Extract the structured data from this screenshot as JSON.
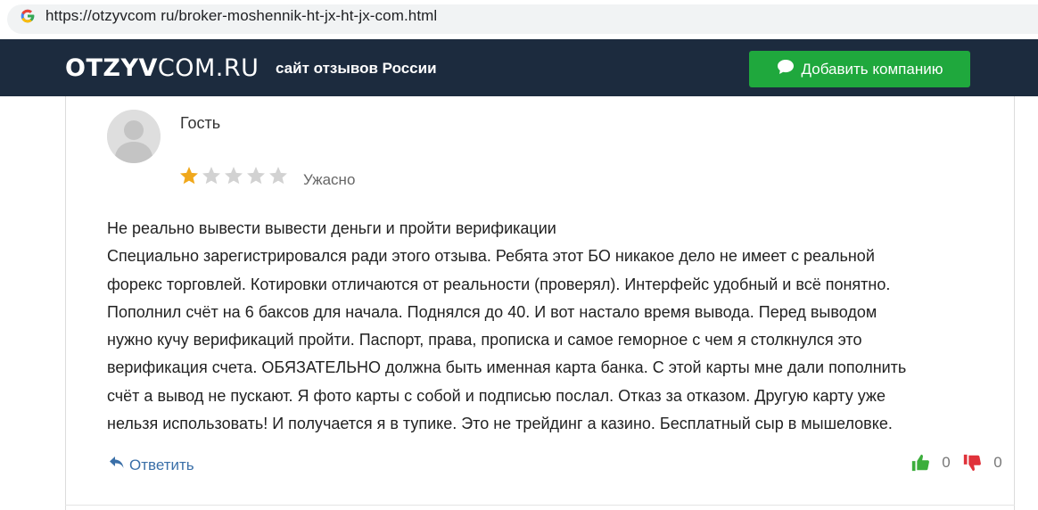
{
  "browser": {
    "url": "https://otzyvcom ru/broker-moshennik-ht-jx-ht-jx-com.html",
    "favicon_icon": "google-g-icon"
  },
  "header": {
    "logo_bold": "OTZYV",
    "logo_rest": "COM.RU",
    "tagline": "сайт отзывов России",
    "add_button_label": "Добавить компанию",
    "add_button_icon": "chat-bubble-icon",
    "accent_color": "#1fa83d",
    "bg_color": "#1c2b3e"
  },
  "review": {
    "author": "Гость",
    "avatar_icon": "user-avatar-icon",
    "rating": 1,
    "rating_max": 5,
    "rating_label": "Ужасно",
    "star_color": "#f0a81c",
    "title": "Не реально вывести вывести деньги и пройти верификации",
    "body_lines": [
      "Специально зарегистрировался ради этого отзыва. Ребята этот БО никакое дело не имеет с реальной",
      "форекс торговлей. Котировки отличаются от реальности (проверял). Интерфейс удобный и всё понятно.",
      "Пополнил счёт на 6 баксов для начала. Поднялся до 40. И вот настало время вывода. Перед выводом",
      "нужно кучу верификаций пройти. Паспорт, права, прописка и самое геморное с чем я столкнулся это",
      "верификация счета. ОБЯЗАТЕЛЬНО должна быть именная карта банка. С этой карты мне дали пополнить",
      "счёт а вывод не пускают. Я фото карты с собой и подписью послал. Отказ за отказом. Другую карту уже",
      "нельзя использовать! И получается я в тупике. Это не трейдинг а казино. Бесплатный сыр в мышеловке."
    ],
    "reply_label": "Ответить",
    "likes": "0",
    "dislikes": "0"
  }
}
